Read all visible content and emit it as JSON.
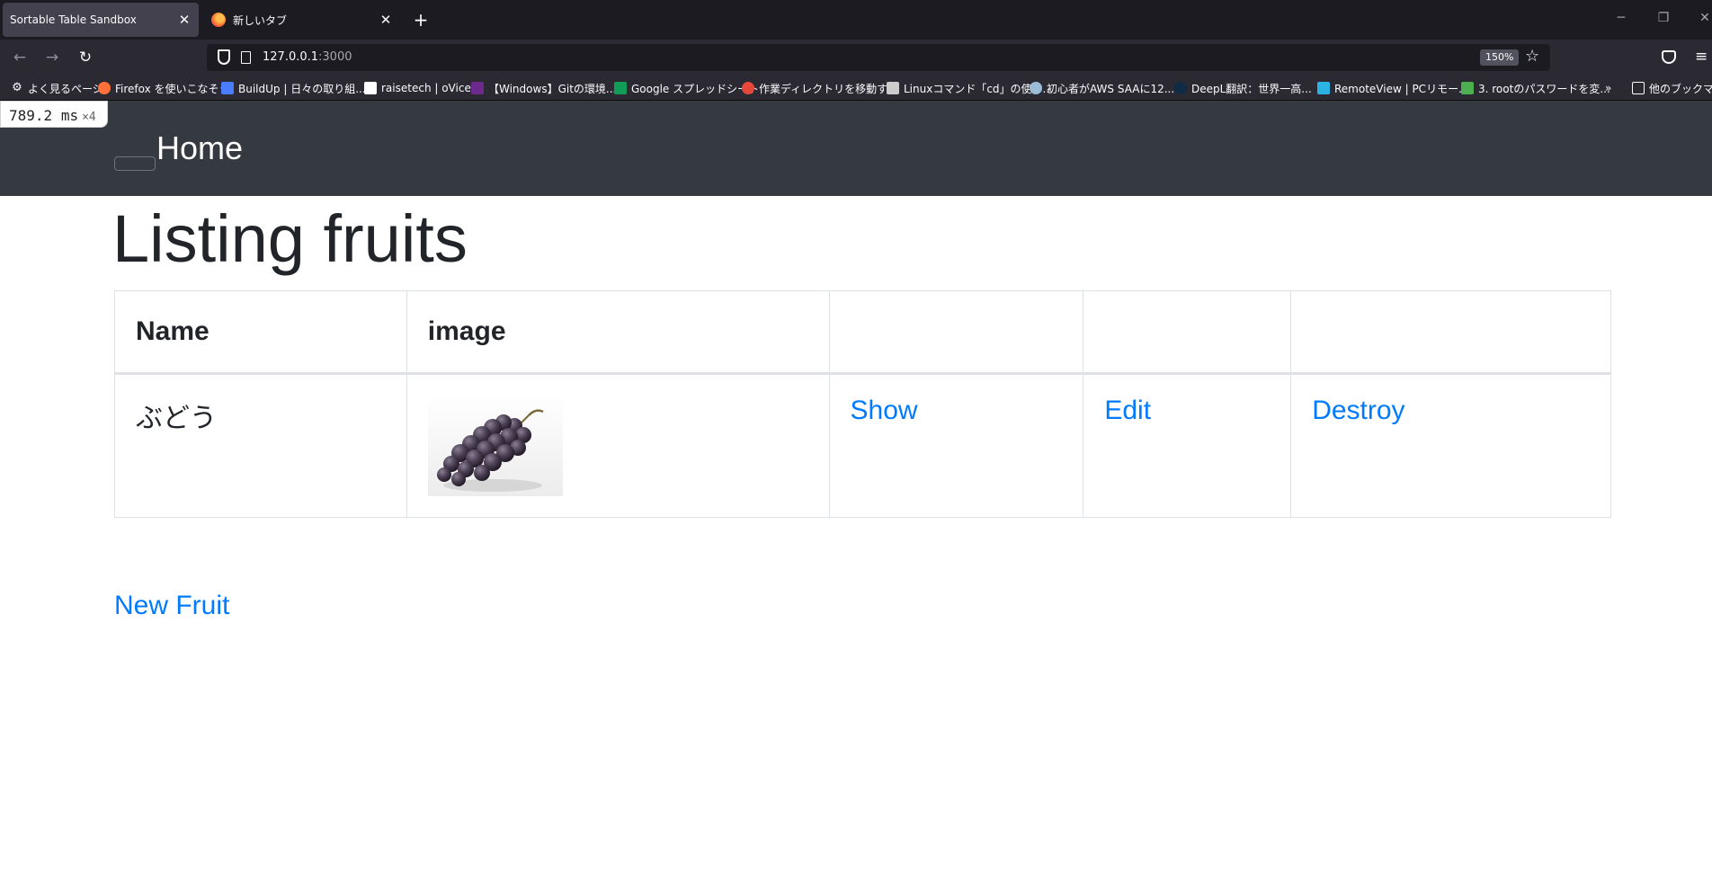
{
  "browser": {
    "tabs": [
      {
        "title": "Sortable Table Sandbox",
        "active": true
      },
      {
        "title": "新しいタブ",
        "active": false
      }
    ],
    "new_tab_label": "+",
    "url": {
      "host": "127.0.0.1",
      "port": ":3000"
    },
    "zoom": "150%",
    "bookmarks": [
      {
        "label": "よく見るページ",
        "icon": "gear-icon",
        "color": "#fbfbfe"
      },
      {
        "label": "Firefox を使いこなそう",
        "icon": "firefox-icon",
        "color": "#ff7139"
      },
      {
        "label": "BuildUp | 日々の取り組...",
        "icon": "buildup-icon",
        "color": "#4a7cff"
      },
      {
        "label": "raisetech | oVice",
        "icon": "ovice-icon",
        "color": "#ffffff"
      },
      {
        "label": "【Windows】Gitの環境...",
        "icon": "site-icon",
        "color": "#6b2a8c"
      },
      {
        "label": "Google スプレッドシート",
        "icon": "sheets-icon",
        "color": "#0f9d58"
      },
      {
        "label": "作業ディレクトリを移動す...",
        "icon": "site-icon",
        "color": "#e5483b"
      },
      {
        "label": "Linuxコマンド「cd」の使い...",
        "icon": "site-icon",
        "color": "#cccccc"
      },
      {
        "label": "初心者がAWS SAAに12...",
        "icon": "wordpress-icon",
        "color": "#9bbcd6"
      },
      {
        "label": "DeepL翻訳：世界一高...",
        "icon": "deepl-icon",
        "color": "#0f2b46"
      },
      {
        "label": "RemoteView | PCリモー...",
        "icon": "remoteview-icon",
        "color": "#2bb3e3"
      },
      {
        "label": "3. rootのパスワードを変...",
        "icon": "site-icon",
        "color": "#4caf50"
      }
    ],
    "more_bookmarks_label": "他のブックマーク"
  },
  "timing": {
    "value": "789.2",
    "unit": "ms",
    "multiplier": "×4"
  },
  "site": {
    "brand": "Home",
    "title": "Listing fruits",
    "table": {
      "headers": [
        "Name",
        "image",
        "",
        "",
        ""
      ],
      "rows": [
        {
          "name": "ぶどう",
          "image_alt": "grape",
          "show": "Show",
          "edit": "Edit",
          "destroy": "Destroy"
        }
      ]
    },
    "new_link": "New Fruit"
  }
}
